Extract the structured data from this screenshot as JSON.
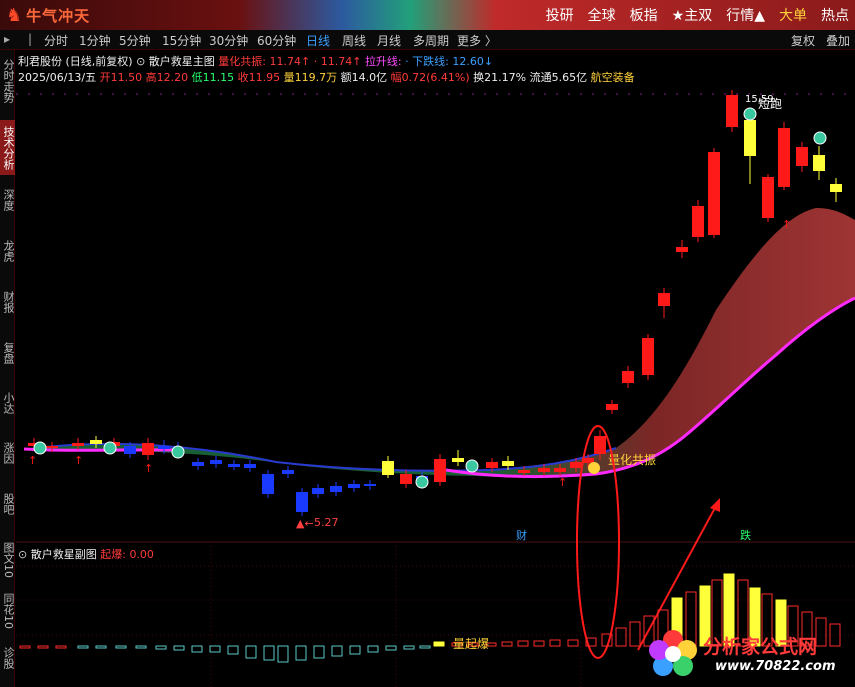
{
  "app": {
    "logo_text": "牛气冲天",
    "top_menu": [
      "投研",
      "全球",
      "板指",
      "★主双",
      "行情▲",
      "大单",
      "热点"
    ]
  },
  "toolbar": {
    "items": [
      "分时",
      "1分钟",
      "5分钟",
      "15分钟",
      "30分钟",
      "60分钟",
      "日线",
      "周线",
      "月线",
      "多周期",
      "更多 〉"
    ],
    "selected": "日线",
    "right_items": [
      "复权",
      "叠加"
    ]
  },
  "sidebar": {
    "tabs": [
      "分时走势",
      "技术分析",
      "深度",
      "龙虎",
      "财报",
      "复盘",
      "小达",
      "涨因",
      "股吧",
      "图文10",
      "同花10",
      "诊股"
    ],
    "active": "技术分析"
  },
  "header": {
    "stock": "利君股份 (日线,前复权)",
    "indicator_name": "散户救星主图",
    "lianghua_label": "量化共振:",
    "lianghua_value": "11.74↑",
    "arrow_value": "· 11.74↑",
    "lasheng_label": "拉升线:",
    "xiadie_label": "· 下跌线:",
    "xiadie_value": "12.60↓",
    "date": "2025/06/13/五",
    "open": "开11.50",
    "high": "高12.20",
    "low": "低11.15",
    "close": "收11.95",
    "volume": "量119.7万",
    "amount": "额14.0亿",
    "amplitude": "幅0.72(6.41%)",
    "turnover": "换21.17%",
    "float_cap": "流通5.65亿",
    "sector": "航空装备"
  },
  "subchart": {
    "title": "散户救星副图",
    "qibao_label": "起爆:",
    "qibao_value": "0.00"
  },
  "annotations": {
    "low_price": "5.27",
    "high_price": "15.59",
    "short_run": "短跑",
    "resonance": "量化共振",
    "qibao_mark": "量起爆",
    "event_cai": "财",
    "event_die": "跌"
  },
  "watermark": {
    "text": "分析家公式网",
    "url": "www.70822.com"
  },
  "colors": {
    "up": "#ff1a1a",
    "down": "#1a3aff",
    "signal_yellow": "#ffff3a",
    "magenta_line": "#ff2aff",
    "band_red": "#b03a3a",
    "band_green": "#1a6a3a"
  }
}
